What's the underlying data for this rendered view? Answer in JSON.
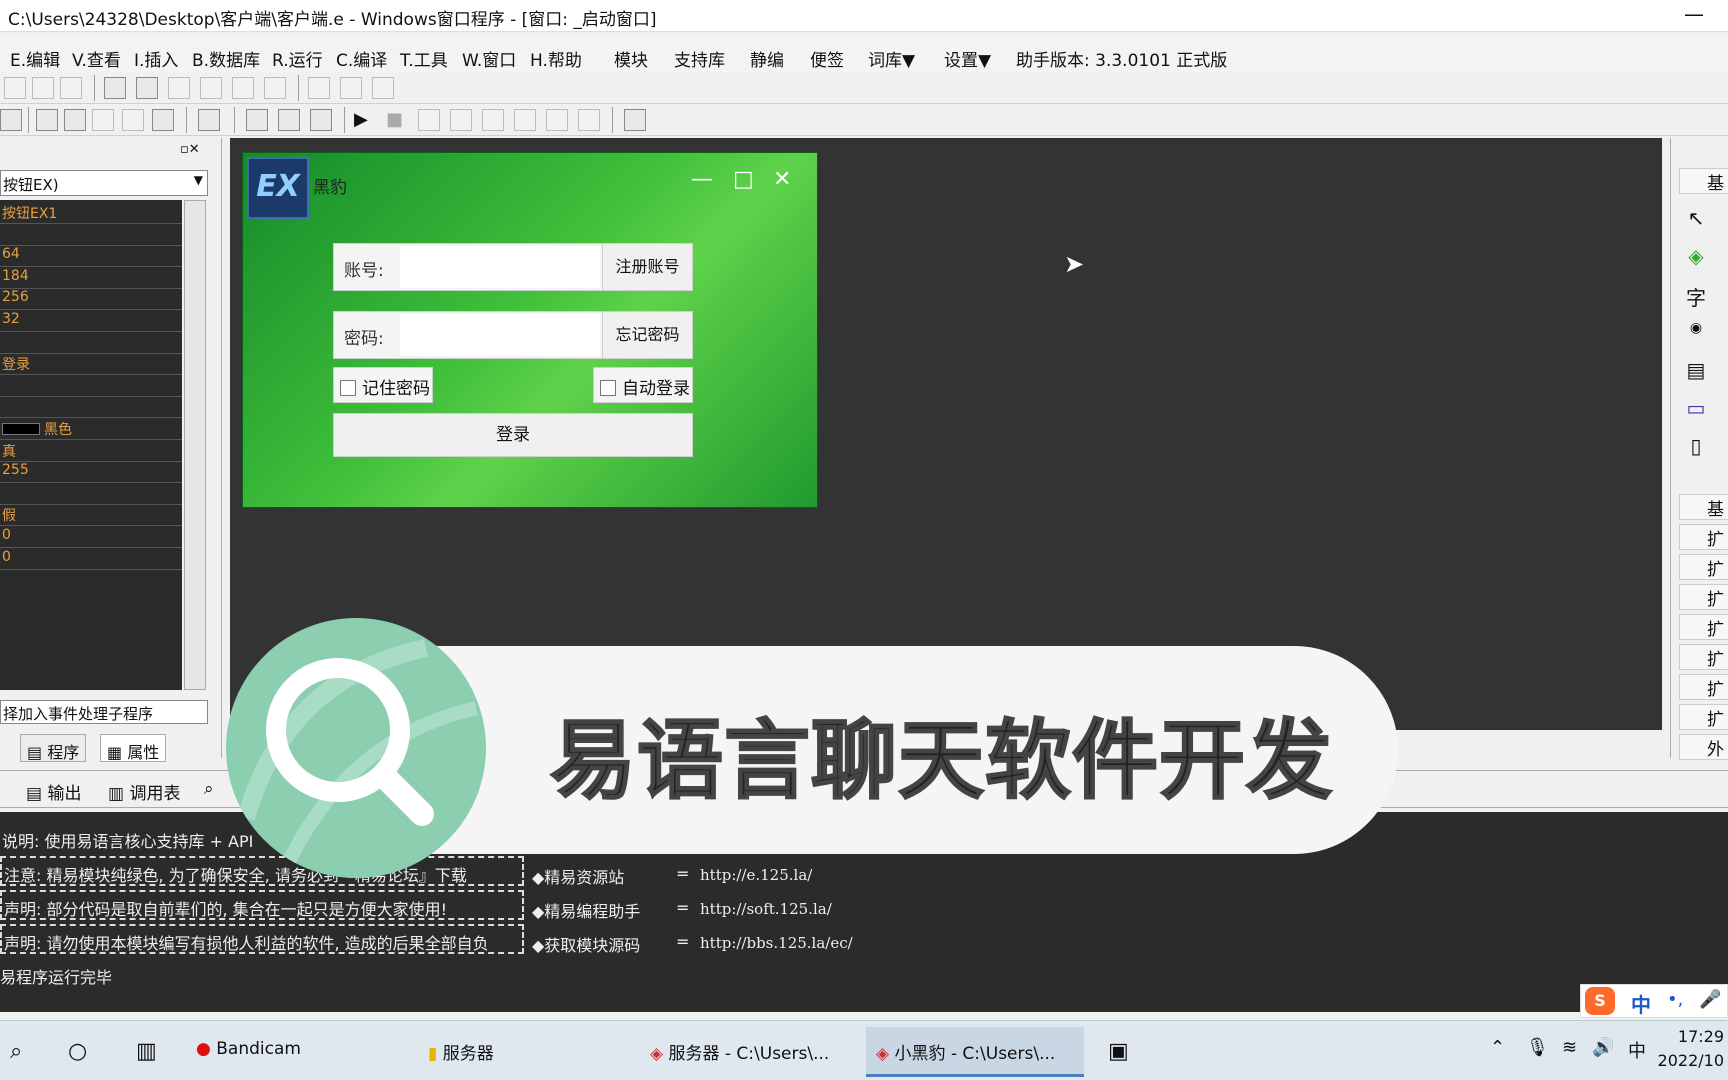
{
  "window": {
    "title": "C:\\Users\\24328\\Desktop\\客户端\\客户端.e - Windows窗口程序 - [窗口: _启动窗口]",
    "minimize": "—"
  },
  "menu": [
    "E.编辑",
    "V.查看",
    "I.插入",
    "B.数据库",
    "R.运行",
    "C.编译",
    "T.工具",
    "W.窗口",
    "H.帮助",
    "模块",
    "支持库",
    "静编",
    "便签",
    "词库▼",
    "设置▼",
    "助手版本: 3.3.0101 正式版"
  ],
  "left_panel": {
    "combo": "按钮EX)",
    "rows": [
      "按钮EX1",
      "",
      "64",
      "184",
      "256",
      "32",
      "",
      "登录",
      "",
      "",
      "黑色",
      "真",
      "255",
      "",
      "假",
      "0",
      "0"
    ],
    "event_combo": "择加入事件处理子程序",
    "tabs": [
      "程序",
      "属性"
    ]
  },
  "right_panel": {
    "items": [
      "基",
      "基",
      "扩",
      "扩",
      "扩",
      "扩",
      "扩",
      "扩",
      "扩",
      "外"
    ],
    "icons": [
      "↖",
      "◈",
      "字",
      "◉",
      "▤",
      "▭",
      "▯"
    ]
  },
  "login_window": {
    "logo": "EX",
    "title": "黑豹",
    "minimize": "—",
    "maximize": "□",
    "close": "✕",
    "account_label": "账号:",
    "register_button": "注册账号",
    "password_label": "密码:",
    "forgot_button": "忘记密码",
    "remember_label": "记住密码",
    "autologin_label": "自动登录",
    "login_button": "登录"
  },
  "bottom_tabs": [
    "输出",
    "调用表"
  ],
  "output": {
    "lines": [
      "说明: 使用易语言核心支持库 + API",
      "注意: 精易模块纯绿色, 为了确保安全, 请务必到『精易论坛』下载",
      "声明: 部分代码是取自前辈们的, 集合在一起只是方便大家使用!",
      "声明: 请勿使用本模块编写有损他人利益的软件, 造成的后果全部自负"
    ],
    "links": [
      {
        "label": "◆精易资源站",
        "eq": "=",
        "url": "http://e.125.la/"
      },
      {
        "label": "◆精易编程助手",
        "eq": "=",
        "url": "http://soft.125.la/"
      },
      {
        "label": "◆获取模块源码",
        "eq": "=",
        "url": "http://bbs.125.la/ec/"
      }
    ],
    "done": "易程序运行完毕"
  },
  "banner": {
    "text": "易语言聊天软件开发"
  },
  "taskbar": {
    "items": [
      "Bandicam",
      "服务器",
      "服务器 - C:\\Users\\...",
      "小黑豹 - C:\\Users\\..."
    ],
    "time": "17:29",
    "date": "2022/10"
  },
  "ime": {
    "chinese": "中",
    "dots": "•,",
    "mic": "🎤"
  },
  "tray": {
    "ime_indicator": "中"
  }
}
